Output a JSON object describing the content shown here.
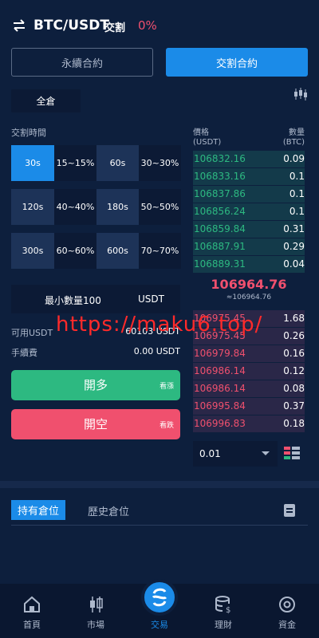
{
  "header": {
    "pair": "BTC/USDT",
    "mode": "交割",
    "change": "0%"
  },
  "contract_tabs": {
    "perpetual": "永續合約",
    "delivery": "交割合約"
  },
  "margin_mode": "全倉",
  "delivery_time_label": "交割時間",
  "time_options": [
    {
      "time": "30s",
      "rate": "15~15%",
      "active": true
    },
    {
      "time": "60s",
      "rate": "30~30%"
    },
    {
      "time": "120s",
      "rate": "40~40%"
    },
    {
      "time": "180s",
      "rate": "50~50%"
    },
    {
      "time": "300s",
      "rate": "60~60%"
    },
    {
      "time": "600s",
      "rate": "70~70%"
    }
  ],
  "min_qty": {
    "label": "最小數量100",
    "unit": "USDT"
  },
  "available": {
    "label": "可用USDT",
    "value": "60103 USDT"
  },
  "fee": {
    "label": "手續費",
    "value": "0.00 USDT"
  },
  "buttons": {
    "long": "開多",
    "long_sub": "看漲",
    "short": "開空",
    "short_sub": "看跌"
  },
  "orderbook": {
    "price_header": "價格",
    "price_unit": "(USDT)",
    "qty_header": "數量",
    "qty_unit": "(BTC)",
    "bids": [
      {
        "price": "106832.16",
        "qty": "0.09"
      },
      {
        "price": "106833.16",
        "qty": "0.1"
      },
      {
        "price": "106837.86",
        "qty": "0.1"
      },
      {
        "price": "106856.24",
        "qty": "0.1"
      },
      {
        "price": "106859.84",
        "qty": "0.31"
      },
      {
        "price": "106887.91",
        "qty": "0.29"
      },
      {
        "price": "106889.31",
        "qty": "0.04"
      }
    ],
    "last_price": "106964.76",
    "index_price": "≈106964.76",
    "asks": [
      {
        "price": "106975.45",
        "qty": "1.68"
      },
      {
        "price": "106975.45",
        "qty": "0.26"
      },
      {
        "price": "106979.84",
        "qty": "0.16"
      },
      {
        "price": "106986.14",
        "qty": "0.12"
      },
      {
        "price": "106986.14",
        "qty": "0.08"
      },
      {
        "price": "106995.84",
        "qty": "0.37"
      },
      {
        "price": "106996.83",
        "qty": "0.18"
      }
    ],
    "depth": "0.01"
  },
  "position_tabs": {
    "open": "持有倉位",
    "history": "歷史倉位"
  },
  "nav": [
    {
      "label": "首頁"
    },
    {
      "label": "市場"
    },
    {
      "label": "交易",
      "active": true
    },
    {
      "label": "理財"
    },
    {
      "label": "資金"
    }
  ],
  "watermark": "https://maku6.top/",
  "colors": {
    "accent": "#1b8be8",
    "up": "#2db981",
    "down": "#f0506e",
    "background": "#0d1f3d"
  }
}
